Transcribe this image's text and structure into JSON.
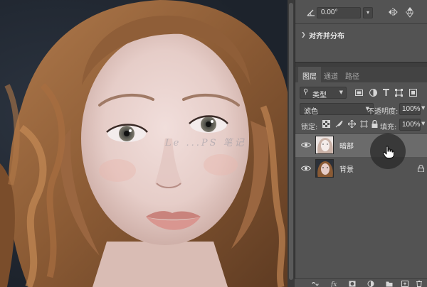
{
  "canvas": {
    "watermark": "Le ...PS 笔记"
  },
  "properties": {
    "angle_value": "0.00°",
    "icons": [
      "angle-icon",
      "flip-horizontal-icon",
      "flip-vertical-icon"
    ]
  },
  "align_section": {
    "title": "对齐并分布"
  },
  "panel_tabs": [
    {
      "label": "图层",
      "active": true
    },
    {
      "label": "通道",
      "active": false
    },
    {
      "label": "路径",
      "active": false
    }
  ],
  "filter": {
    "label": "类型",
    "icons": [
      "pixel-filter-icon",
      "adjustment-filter-icon",
      "type-filter-icon",
      "shape-filter-icon",
      "smart-object-filter-icon"
    ]
  },
  "blend": {
    "mode": "滤色",
    "opacity_label": "不透明度:",
    "opacity_value": "100%"
  },
  "lock": {
    "label": "锁定:",
    "fill_label": "填充:",
    "fill_value": "100%"
  },
  "layers": [
    {
      "name": "暗部",
      "visible": true,
      "selected": true,
      "locked": false
    },
    {
      "name": "背景",
      "visible": true,
      "selected": false,
      "locked": true
    }
  ],
  "colors": {
    "panel_bg": "#535353",
    "selected_layer": "#6b6b6b",
    "input_bg": "#454545"
  }
}
